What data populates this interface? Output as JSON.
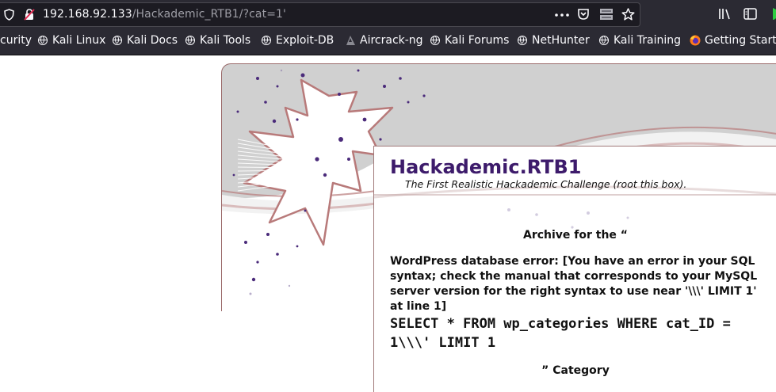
{
  "browser": {
    "url_host": "192.168.92.133",
    "url_path": "/Hackademic_RTB1/?cat=1'",
    "icons": [
      "shield-icon",
      "insecure-lock-icon",
      "more-icon",
      "pocket-icon",
      "reader-icon",
      "bookmark-star-icon",
      "library-icon",
      "sidebar-icon",
      "extension-icon"
    ]
  },
  "bookmarks": [
    {
      "label": "curity",
      "icon": "globe-icon"
    },
    {
      "label": "Kali Linux",
      "icon": "globe-icon"
    },
    {
      "label": "Kali Docs",
      "icon": "globe-icon"
    },
    {
      "label": "Kali Tools",
      "icon": "globe-icon"
    },
    {
      "label": "Exploit-DB",
      "icon": "globe-icon"
    },
    {
      "label": "Aircrack-ng",
      "icon": "aircrack-icon"
    },
    {
      "label": "Kali Forums",
      "icon": "globe-icon"
    },
    {
      "label": "NetHunter",
      "icon": "globe-icon"
    },
    {
      "label": "Kali Training",
      "icon": "globe-icon"
    },
    {
      "label": "Getting Starte",
      "icon": "firefox-icon"
    }
  ],
  "blog": {
    "title": "Hackademic.RTB1",
    "description": "The First Realistic Hackademic Challenge (root this box).",
    "archive_title": "Archive for the “",
    "db_error": "WordPress database error: [You have an error in your SQL syntax; check the manual that corresponds to your MySQL server version for the right syntax to use near '\\\\\\' LIMIT 1' at line 1]",
    "sql_query": "SELECT * FROM wp_categories WHERE cat_ID = 1\\\\\\' LIMIT 1",
    "category_label": "” Category"
  },
  "colors": {
    "chrome_bg": "#2b2a33",
    "urlbar_bg": "#1c1b22",
    "title_purple": "#3d1b6b",
    "splash_red": "#b87a7a",
    "header_gray": "#d0d0d0"
  }
}
